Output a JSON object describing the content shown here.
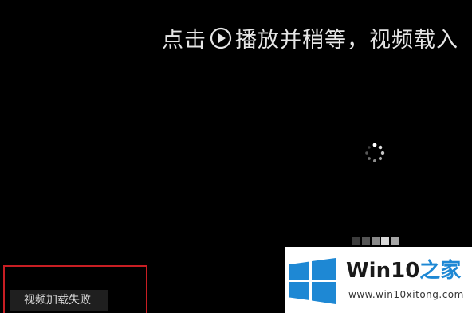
{
  "player": {
    "hint_before": "点击",
    "hint_after": "播放并稍等，视频载入",
    "error_text": "视频加载失败",
    "icons": [
      "play-circle-icon",
      "loading-spinner-icon",
      "windows-logo-icon"
    ]
  },
  "pager": {
    "dot_colors": [
      "#3c3c3c",
      "#555555",
      "#8a8a8a",
      "#d9d9d9",
      "#a6a6a6"
    ]
  },
  "watermark": {
    "brand_main": "Win10",
    "brand_accent": "之家",
    "url": "www.win10xitong.com"
  },
  "colors": {
    "background": "#000000",
    "error_outline": "#c81e23",
    "windows_blue": "#1e88d4"
  }
}
